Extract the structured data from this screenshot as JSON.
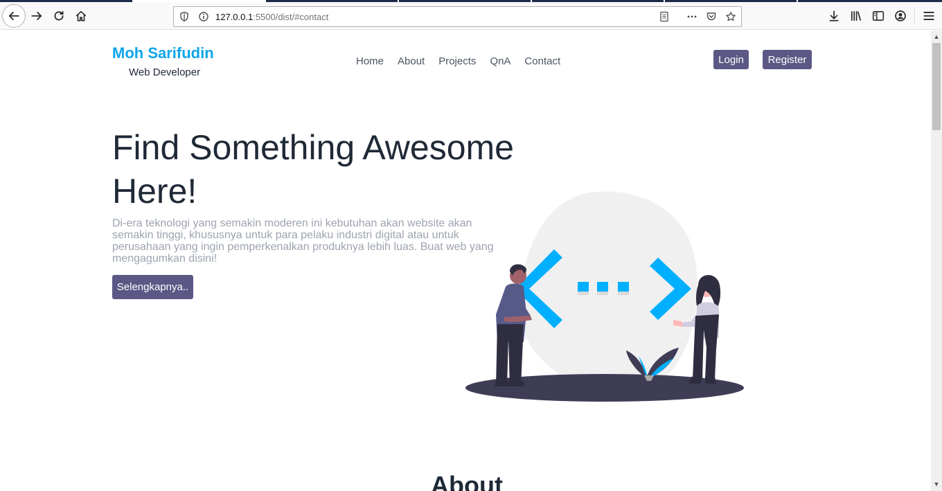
{
  "browser": {
    "url_host": "127.0.0.1",
    "url_rest": ":5500/dist/#contact"
  },
  "header": {
    "brand_name": "Moh Sarifudin",
    "brand_subtitle": "Web Developer",
    "nav": [
      "Home",
      "About",
      "Projects",
      "QnA",
      "Contact"
    ],
    "login_label": "Login",
    "register_label": "Register"
  },
  "hero": {
    "title": "Find Something Awesome Here!",
    "description": "Di-era teknologi yang semakin moderen ini kebutuhan akan website akan semakin tinggi, khususnya untuk para pelaku industri digital atau untuk perusahaan yang ingin pemperkenalkan produknya lebih luas. Buat web yang mengagumkan disini!",
    "cta_label": "Selengkapnya.."
  },
  "about": {
    "heading": "About"
  },
  "colors": {
    "brand": "#0ea5e9",
    "button": "#5b5885",
    "code_blue": "#00b0ff",
    "ground": "#3f3d56"
  },
  "icons": [
    "back-icon",
    "forward-icon",
    "reload-icon",
    "home-icon",
    "shield-icon",
    "info-icon",
    "reader-icon",
    "more-icon",
    "pocket-icon",
    "star-icon",
    "download-icon",
    "library-icon",
    "sidebar-icon",
    "account-icon",
    "menu-icon"
  ]
}
